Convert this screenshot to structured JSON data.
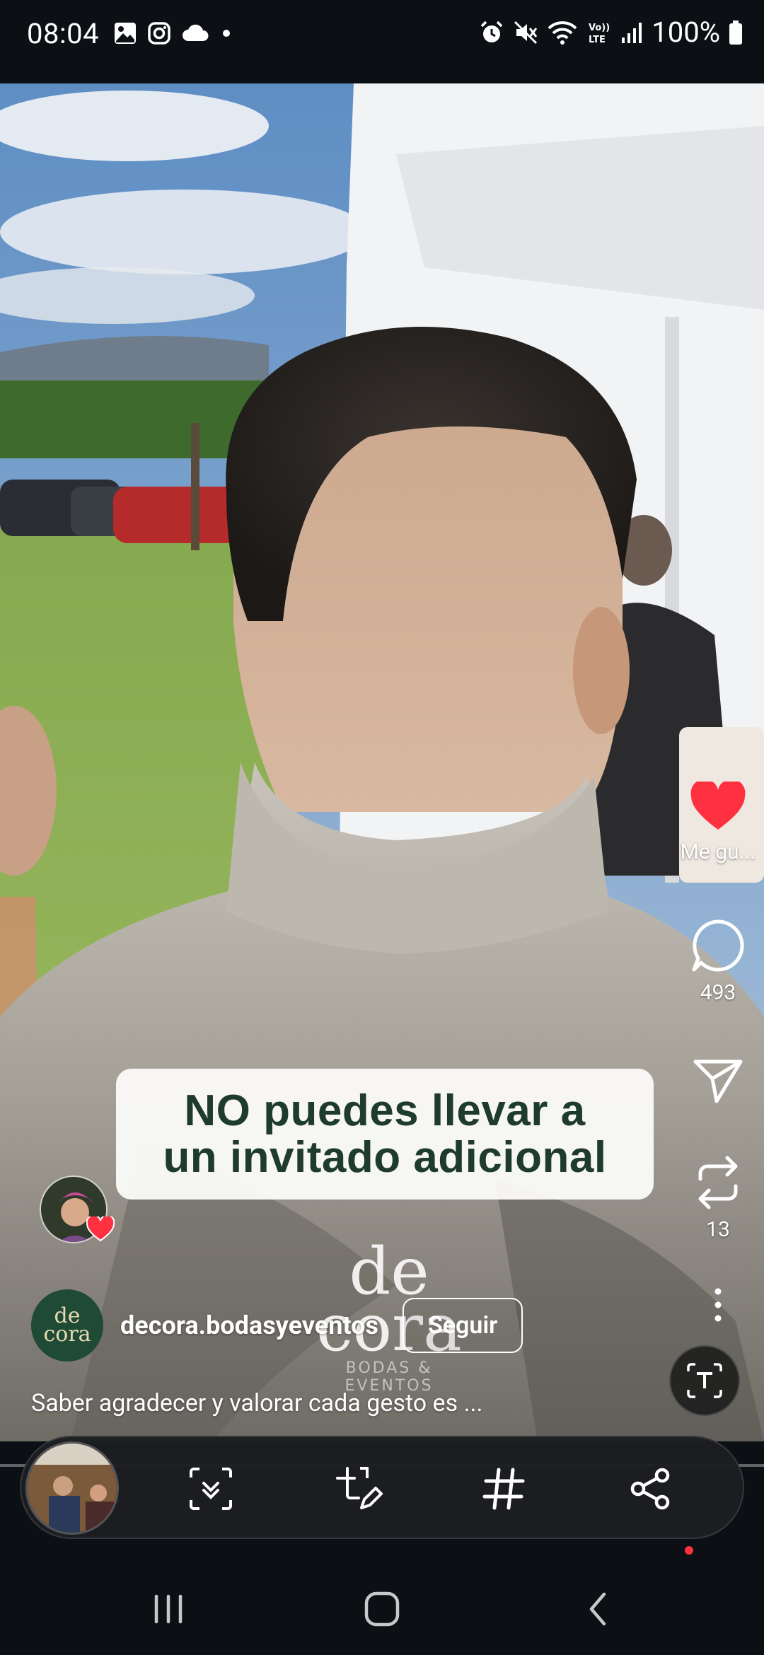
{
  "status_bar": {
    "time": "08:04",
    "battery": "100%",
    "left_icons": [
      "gallery-icon",
      "instagram-icon",
      "cloud-icon",
      "dot-icon"
    ],
    "right_icons": [
      "alarm-icon",
      "mute-icon",
      "wifi-icon",
      "volte-icon",
      "signal-icon",
      "battery-icon"
    ]
  },
  "video": {
    "caption_line1": "NO puedes llevar a",
    "caption_line2": "un invitado adicional",
    "watermark_line1": "de",
    "watermark_line2": "cora",
    "watermark_sub": "BODAS & EVENTOS"
  },
  "actions": {
    "like_label": "Me gu...",
    "comment_count": "493",
    "repost_count": "13",
    "like_color": "#ff3040"
  },
  "account": {
    "logo_line1": "de",
    "logo_line2": "cora",
    "name": "decora.bodasyeventos",
    "follow_label": "Seguir"
  },
  "description": "Saber agradecer y valorar cada gesto es ...",
  "toolbar": {
    "items": [
      "scroll-capture-icon",
      "edit-icon",
      "hashtag-icon",
      "share-icon"
    ]
  },
  "navbar": {
    "items": [
      "recents-icon",
      "home-icon",
      "back-icon"
    ]
  }
}
